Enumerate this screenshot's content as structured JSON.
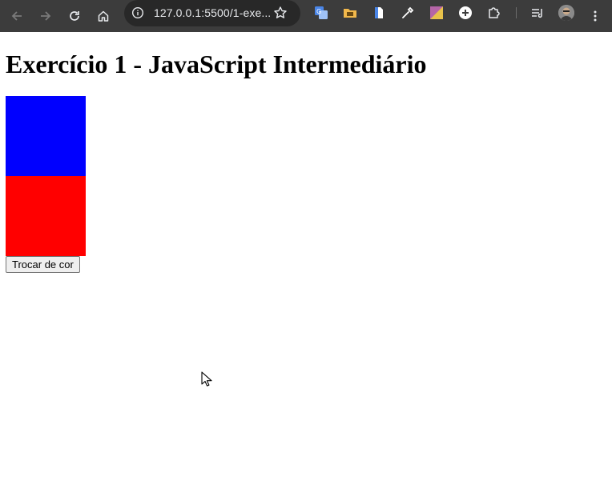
{
  "browser": {
    "url": "127.0.0.1:5500/1-exe...",
    "colors": {
      "toolbar": "#3c3c3c",
      "omnibox": "#282828"
    }
  },
  "page": {
    "title": "Exercício 1 - JavaScript Intermediário",
    "boxes": [
      {
        "name": "blue-box",
        "color": "#0000ff"
      },
      {
        "name": "red-box",
        "color": "#ff0000"
      }
    ],
    "button_label": "Trocar de cor"
  }
}
